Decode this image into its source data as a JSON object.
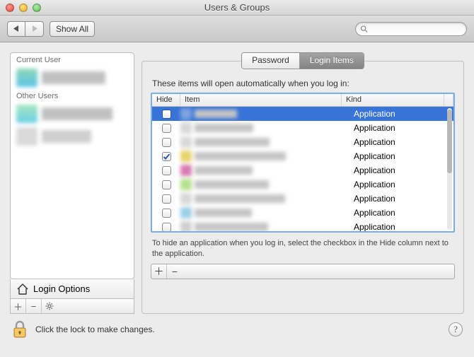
{
  "window": {
    "title": "Users & Groups"
  },
  "toolbar": {
    "show_all": "Show All",
    "search_placeholder": ""
  },
  "sidebar": {
    "section_current": "Current User",
    "section_other": "Other Users",
    "login_options": "Login Options"
  },
  "tabs": {
    "password": "Password",
    "login_items": "Login Items",
    "active": "login_items"
  },
  "login_items": {
    "instruction": "These items will open automatically when you log in:",
    "columns": {
      "hide": "Hide",
      "item": "Item",
      "kind": "Kind"
    },
    "rows": [
      {
        "hide": false,
        "kind": "Application",
        "selected": true
      },
      {
        "hide": false,
        "kind": "Application"
      },
      {
        "hide": false,
        "kind": "Application"
      },
      {
        "hide": true,
        "kind": "Application"
      },
      {
        "hide": false,
        "kind": "Application"
      },
      {
        "hide": false,
        "kind": "Application"
      },
      {
        "hide": false,
        "kind": "Application"
      },
      {
        "hide": false,
        "kind": "Application"
      },
      {
        "hide": false,
        "kind": "Application"
      }
    ],
    "hint": "To hide an application when you log in, select the checkbox in the Hide column next to the application."
  },
  "lock": {
    "text": "Click the lock to make changes."
  }
}
